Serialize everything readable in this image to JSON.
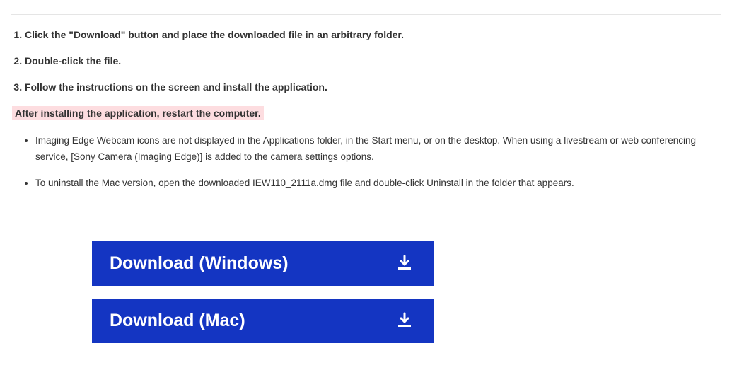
{
  "steps": {
    "items": [
      "Click the \"Download\" button and place the downloaded file in an arbitrary folder.",
      "Double-click the file.",
      "Follow the instructions on the screen and install the application."
    ]
  },
  "highlight_text": "After installing the application, restart the computer.",
  "notes": {
    "items": [
      "Imaging Edge Webcam icons are not displayed in the Applications folder, in the Start menu, or on the desktop. When using a livestream or web conferencing service, [Sony Camera (Imaging Edge)] is added to the camera settings options.",
      "To uninstall the Mac version, open the downloaded IEW110_2111a.dmg file and double-click Uninstall in the folder that appears."
    ]
  },
  "buttons": {
    "windows": "Download (Windows)",
    "mac": "Download (Mac)"
  }
}
